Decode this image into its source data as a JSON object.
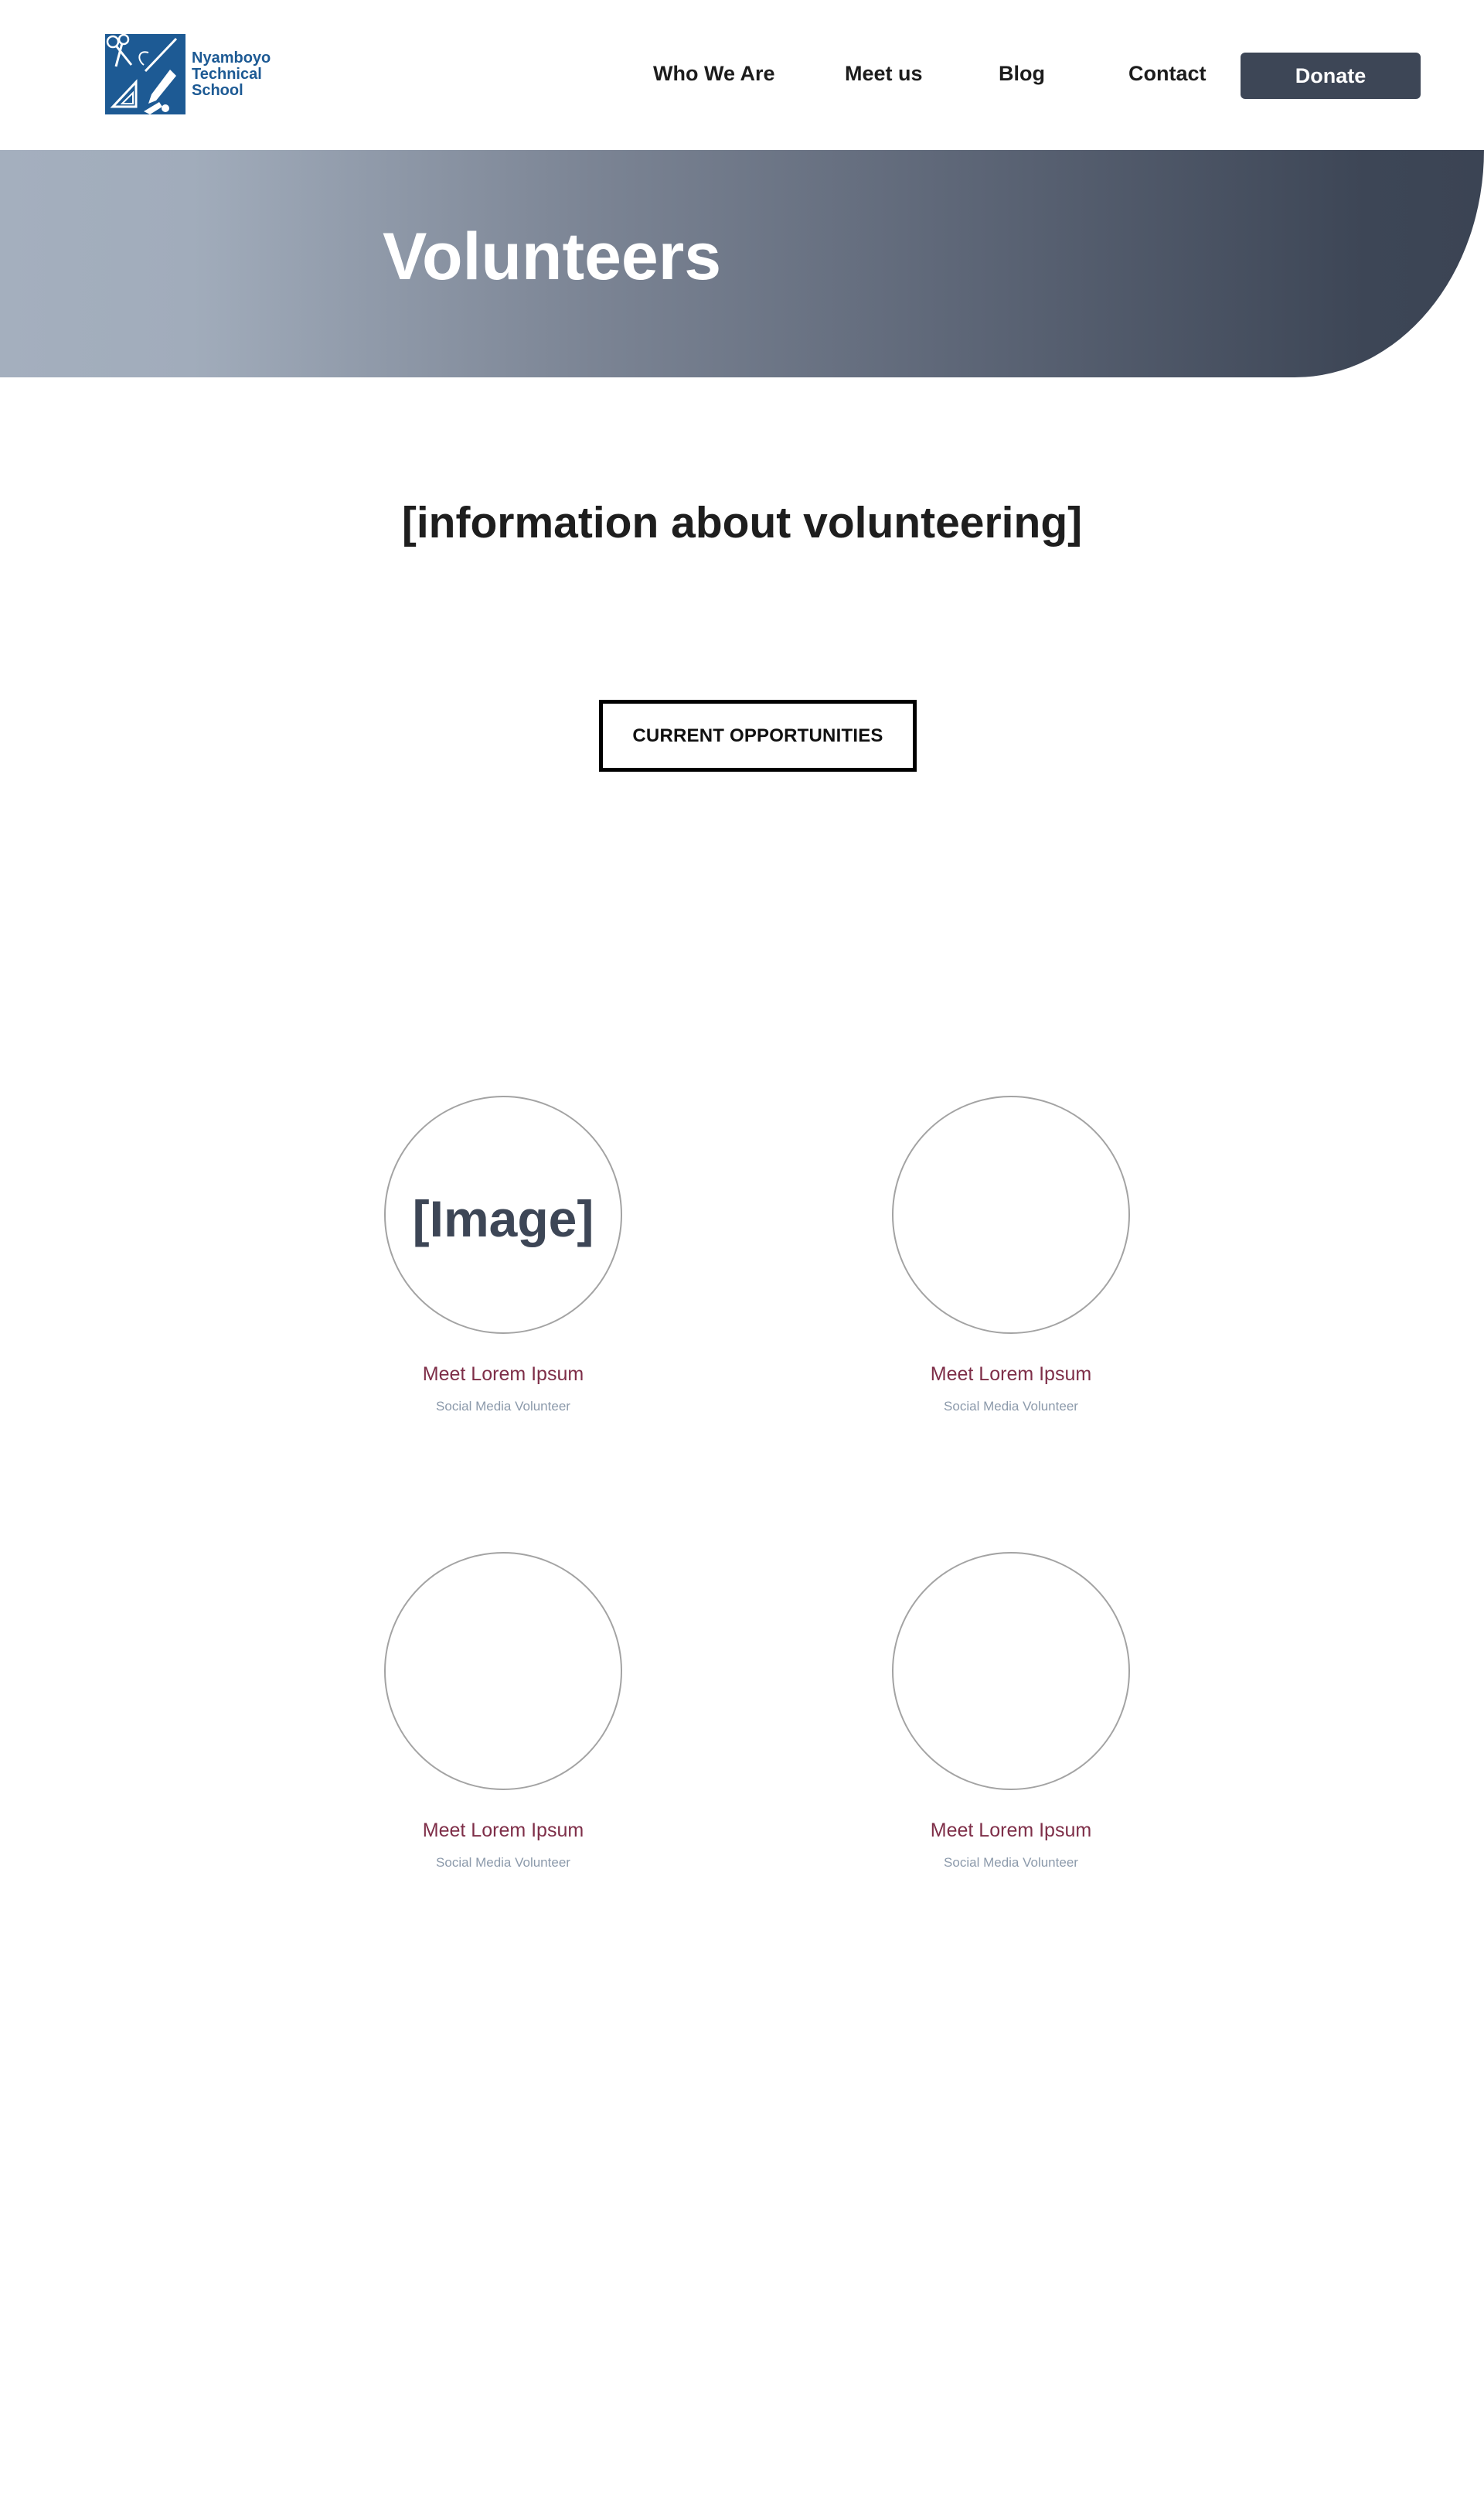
{
  "header": {
    "logo": {
      "line1": "Nyamboyo",
      "line2": "Technical",
      "line3": "School",
      "icon": "school-crest-icon",
      "brand_color": "#1d5a94"
    },
    "nav": {
      "who_we_are": "Who We Are",
      "meet_us": "Meet us",
      "blog": "Blog",
      "contact": "Contact"
    },
    "donate_label": "Donate",
    "donate_color": "#3d4656"
  },
  "hero": {
    "title": "Volunteers",
    "gradient_start": "#a4afbe",
    "gradient_end": "#3b4454"
  },
  "intro": {
    "text": "[information about volunteering]"
  },
  "opportunities_button": "CURRENT OPPORTUNITIES",
  "volunteers": [
    {
      "image_placeholder": "[Image]",
      "name": "Meet Lorem Ipsum",
      "role": "Social Media Volunteer"
    },
    {
      "image_placeholder": "",
      "name": "Meet Lorem Ipsum",
      "role": "Social Media Volunteer"
    },
    {
      "image_placeholder": "",
      "name": "Meet Lorem Ipsum",
      "role": "Social Media Volunteer"
    },
    {
      "image_placeholder": "",
      "name": "Meet Lorem Ipsum",
      "role": "Social Media Volunteer"
    }
  ],
  "colors": {
    "name_color": "#7e2e48",
    "role_color": "#8c9aab"
  }
}
